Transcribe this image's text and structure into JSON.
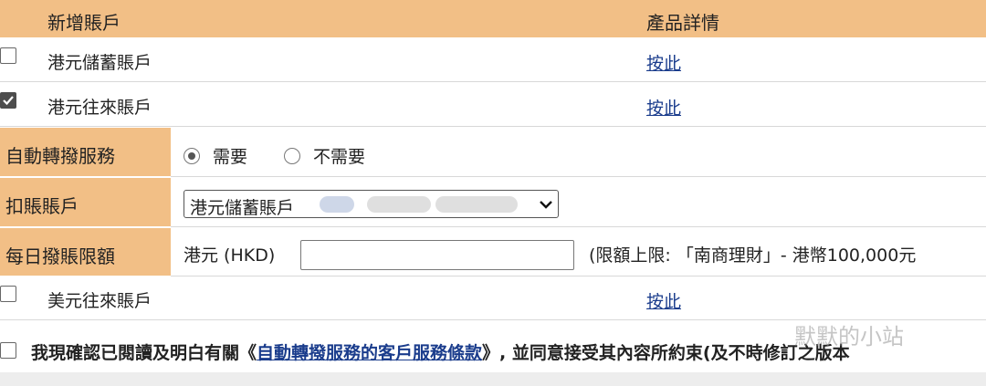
{
  "header": {
    "col_account": "新增賬戶",
    "col_details": "產品詳情"
  },
  "accounts": [
    {
      "label": "港元儲蓄賬戶",
      "link": "按此",
      "checked": false
    },
    {
      "label": "港元往來賬戶",
      "link": "按此",
      "checked": true
    },
    {
      "label": "美元往來賬戶",
      "link": "按此",
      "checked": false
    }
  ],
  "autotransfer": {
    "label": "自動轉撥服務",
    "option_yes": "需要",
    "option_no": "不需要",
    "selected": "需要"
  },
  "debit_account": {
    "label": "扣賬賬戶",
    "selected": "港元儲蓄賬戶"
  },
  "daily_limit": {
    "label": "每日撥賬限額",
    "currency": "港元 (HKD)",
    "value": "",
    "note": "(限額上限: 「南商理財」- 港幣100,000元"
  },
  "consent": {
    "prefix": "我現確認已閱讀及明白有關",
    "open_quote": "《",
    "link": "自動轉撥服務的客戶服務條款",
    "suffix": "》, 並同意接受其內容所約束(及不時修訂之版本"
  },
  "watermark": "默默的小站"
}
